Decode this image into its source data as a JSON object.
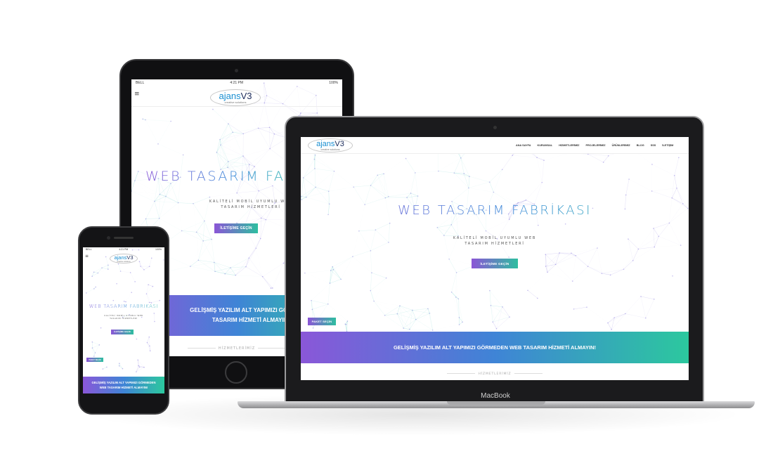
{
  "brand": {
    "logo_a": "ajans",
    "logo_v": "V3",
    "logo_sub": "creative solutions"
  },
  "laptop": {
    "device_label": "MacBook",
    "nav": [
      "ANA SAYFA",
      "KURUMSAL",
      "HİZMETLERİMİZ",
      "PROJELERİMİZ",
      "ÜRÜNLERİMİZ",
      "BLOG",
      "SSS",
      "İLETİŞİM"
    ],
    "hero_title": "WEB TASARIM FABRİKASI",
    "hero_sub_line1": "KALİTELİ MOBİL UYUMLU WEB",
    "hero_sub_line2": "TASARIM HİZMETLERİ",
    "contact_button": "İLETİŞİME GEÇİN",
    "package_button": "PAKET SEÇİN",
    "band_text": "GELİŞMİŞ YAZILIM ALT YAPIMIZI GÖRMEDEN WEB TASARIM HİZMETİ ALMAYIN!",
    "services_label": "HİZMETLERİMİZ"
  },
  "tablet": {
    "status_carrier": "BELL",
    "status_time": "4:21 PM",
    "status_battery": "100%",
    "hamburger": "≡",
    "hero_title": "WEB TASARIM FABR",
    "hero_sub_line1": "KALİTELİ MOBİL UYUMLU WEB",
    "hero_sub_line2": "TASARIM HİZMETLERİ",
    "contact_button": "İLETİŞİME GEÇİN",
    "band_line1": "GELİŞMİŞ YAZILIM ALT YAPIMIZI GÖRMEDEN",
    "band_line2": "TASARIM HİZMETİ ALMAYIN!",
    "services_label": "HİZMETLERİMİZ"
  },
  "phone": {
    "status_carrier": "BELL",
    "status_time": "4:21 PM",
    "status_battery": "100%",
    "hamburger": "≡",
    "hero_title": "WEB TASARIM FABRİKASI",
    "hero_sub_line1": "KALİTELİ MOBİL UYUMLU WEB",
    "hero_sub_line2": "TASARIM HİZMETLERİ",
    "contact_button": "İLETİŞİME GEÇİN",
    "package_button": "PAKET SEÇİN",
    "band_line1": "GELİŞMİŞ YAZILIM ALT YAPIMIZI GÖRMEDEN",
    "band_line2": "WEB TASARIM HİZMETİ ALMAYIN!"
  },
  "colors": {
    "gradient_start": "#8a57d8",
    "gradient_mid": "#3f84d6",
    "gradient_end": "#2cc89e",
    "logo_blue": "#1a8fd1",
    "logo_navy": "#1a2a5a"
  }
}
